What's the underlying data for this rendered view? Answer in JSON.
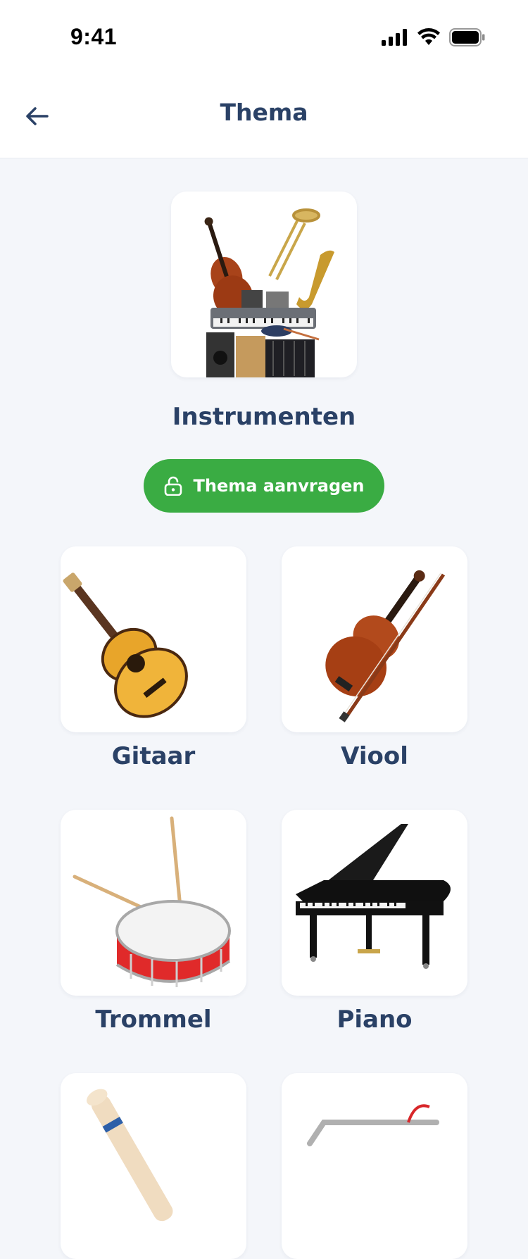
{
  "status": {
    "time": "9:41"
  },
  "header": {
    "title": "Thema"
  },
  "theme": {
    "name": "Instrumenten",
    "request_label": "Thema aanvragen"
  },
  "items": [
    {
      "label": "Gitaar"
    },
    {
      "label": "Viool"
    },
    {
      "label": "Trommel"
    },
    {
      "label": "Piano"
    },
    {
      "label": ""
    },
    {
      "label": ""
    }
  ],
  "colors": {
    "accent": "#3aac43",
    "title": "#2a4166",
    "background": "#f4f6fa"
  },
  "icons": [
    "back-arrow-icon",
    "signal-icon",
    "wifi-icon",
    "battery-icon",
    "unlock-icon"
  ]
}
